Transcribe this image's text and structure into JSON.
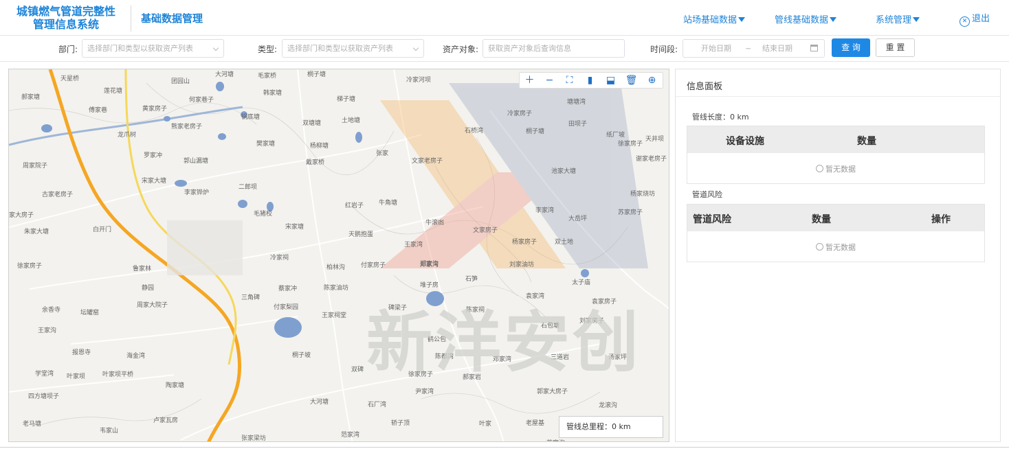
{
  "header": {
    "app_title_line1": "城镇燃气管道完整性",
    "app_title_line2": "管理信息系统",
    "module_title": "基础数据管理",
    "nav": [
      {
        "label": "站场基础数据"
      },
      {
        "label": "管线基础数据"
      },
      {
        "label": "系统管理"
      }
    ],
    "logout_label": "退出"
  },
  "filters": {
    "department_label": "部门:",
    "department_placeholder": "选择部门和类型以获取资产列表",
    "type_label": "类型:",
    "type_placeholder": "选择部门和类型以获取资产列表",
    "asset_label": "资产对象:",
    "asset_placeholder": "获取资产对象后查询信息",
    "period_label": "时间段:",
    "start_placeholder": "开始日期",
    "range_sep": "~",
    "end_placeholder": "结束日期",
    "query_button": "查 询",
    "reset_button": "重 置"
  },
  "map": {
    "summary": "管线总里程：0 km",
    "watermark": "新洋安创",
    "toolbar": [
      "zoom-in-icon",
      "zoom-out-icon",
      "fit-extent-icon",
      "measure-line-icon",
      "measure-area-icon",
      "clear-icon",
      "globe-icon"
    ],
    "places": [
      {
        "name": "天星桥"
      },
      {
        "name": "莲花塘"
      },
      {
        "name": "团园山"
      },
      {
        "name": "大河塘"
      },
      {
        "name": "毛家桥"
      },
      {
        "name": "桐子塘"
      },
      {
        "name": "冷家河坝"
      },
      {
        "name": "郝家塘"
      },
      {
        "name": "何家巷子"
      },
      {
        "name": "韩家塘"
      },
      {
        "name": "梯子塘"
      },
      {
        "name": "傅家巷"
      },
      {
        "name": "黄家房子"
      },
      {
        "name": "锅底塘"
      },
      {
        "name": "双塘塘"
      },
      {
        "name": "土地塘"
      },
      {
        "name": "熊家老房子"
      },
      {
        "name": "龙爪树"
      },
      {
        "name": "樊家塘"
      },
      {
        "name": "杨柳塘"
      },
      {
        "name": "罗家冲"
      },
      {
        "name": "郭山漏塘"
      },
      {
        "name": "戴家桥"
      },
      {
        "name": "张家"
      },
      {
        "name": "周家院子"
      },
      {
        "name": "宋家大塘"
      },
      {
        "name": "二郎坝"
      },
      {
        "name": "李家铧炉"
      },
      {
        "name": "古家老房子"
      },
      {
        "name": "红岩子"
      },
      {
        "name": "牛角塘"
      },
      {
        "name": "毛猪校"
      },
      {
        "name": "家大房子"
      },
      {
        "name": "朱家大塘"
      },
      {
        "name": "白开门"
      },
      {
        "name": "宋家塘"
      },
      {
        "name": "天鹅抱蛋"
      },
      {
        "name": "徐家房子"
      },
      {
        "name": "鲁家林"
      },
      {
        "name": "冷家祠"
      },
      {
        "name": "柏林沟"
      },
      {
        "name": "付家房子"
      },
      {
        "name": "郑家沟"
      },
      {
        "name": "静园"
      },
      {
        "name": "蔡家冲"
      },
      {
        "name": "陈家油坊"
      },
      {
        "name": "三角碑"
      },
      {
        "name": "付家梨园"
      },
      {
        "name": "周家大院子"
      },
      {
        "name": "余香寺"
      },
      {
        "name": "坛罐窑"
      },
      {
        "name": "王家祠堂"
      },
      {
        "name": "王家沟"
      },
      {
        "name": "报恩寺"
      },
      {
        "name": "海金湾"
      },
      {
        "name": "桐子坡"
      },
      {
        "name": "学堂湾"
      },
      {
        "name": "叶家坝"
      },
      {
        "name": "叶家坝平桥"
      },
      {
        "name": "陶家塘"
      },
      {
        "name": "四方塘坝子"
      },
      {
        "name": "大河塘"
      },
      {
        "name": "石厂湾"
      },
      {
        "name": "老马塘"
      },
      {
        "name": "韦家山"
      },
      {
        "name": "卢家瓦房"
      },
      {
        "name": "张家梁坊"
      },
      {
        "name": "范家湾"
      },
      {
        "name": "轿子顶"
      },
      {
        "name": "叶家"
      },
      {
        "name": "老屋基"
      },
      {
        "name": "苏家沟"
      },
      {
        "name": "龙滚沟"
      },
      {
        "name": "郭家大房子"
      },
      {
        "name": "三道岩"
      },
      {
        "name": "汤家坪"
      },
      {
        "name": "刘家房子"
      },
      {
        "name": "石包塘"
      },
      {
        "name": "袁家湾"
      },
      {
        "name": "袁家房子"
      },
      {
        "name": "太子庙"
      },
      {
        "name": "刘家油坊"
      },
      {
        "name": "杨家房子"
      },
      {
        "name": "双土地"
      },
      {
        "name": "文家房子"
      },
      {
        "name": "牛滚凼"
      },
      {
        "name": "王家湾"
      },
      {
        "name": "郑家湾"
      },
      {
        "name": "堆子房"
      },
      {
        "name": "石笋"
      },
      {
        "name": "碑梁子"
      },
      {
        "name": "陈家祠"
      },
      {
        "name": "鹤公包"
      },
      {
        "name": "陈都湾"
      },
      {
        "name": "邓家湾"
      },
      {
        "name": "双碑"
      },
      {
        "name": "徐家房子"
      },
      {
        "name": "尹家湾"
      },
      {
        "name": "郝家岩"
      },
      {
        "name": "李家湾"
      },
      {
        "name": "大岳坪"
      },
      {
        "name": "苏家房子"
      },
      {
        "name": "池家大塘"
      },
      {
        "name": "文家老房子"
      },
      {
        "name": "石桥湾"
      },
      {
        "name": "桐子塘"
      },
      {
        "name": "田坝子"
      },
      {
        "name": "纸厂坡"
      },
      {
        "name": "天井坝"
      },
      {
        "name": "谢家老房子"
      },
      {
        "name": "杨家烧坊"
      },
      {
        "name": "徐家房子"
      },
      {
        "name": "塘塘湾"
      },
      {
        "name": "冷家房子"
      }
    ]
  },
  "panel": {
    "title": "信息面板",
    "pipe_length_label": "管线长度：0 km",
    "facility_table": {
      "columns": [
        "设备设施",
        "数量"
      ],
      "empty_text": "暂无数据"
    },
    "risk_section_label": "管道风险",
    "risk_table": {
      "columns": [
        "管道风险",
        "数量",
        "操作"
      ],
      "empty_text": "暂无数据"
    }
  },
  "colors": {
    "accent": "#1e84d8",
    "primary_button": "#1e88e5",
    "road_main": "#f5a623",
    "water": "#7f9fcf"
  }
}
